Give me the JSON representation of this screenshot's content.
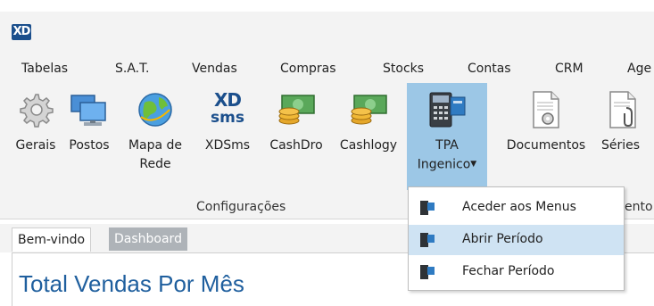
{
  "app": {
    "logo_text": "XD"
  },
  "menubar": {
    "items": [
      "Tabelas",
      "S.A.T.",
      "Vendas",
      "Compras",
      "Stocks",
      "Contas",
      "CRM",
      "Age"
    ]
  },
  "ribbon": {
    "buttons": [
      {
        "line1": "Gerais",
        "line2": "",
        "icon": "gear-icon"
      },
      {
        "line1": "Postos",
        "line2": "",
        "icon": "computer-icon"
      },
      {
        "line1": "Mapa de",
        "line2": "Rede",
        "icon": "globe-icon"
      },
      {
        "line1": "XDSms",
        "line2": "",
        "icon": "xdsms-icon"
      },
      {
        "line1": "CashDro",
        "line2": "",
        "icon": "cash-icon"
      },
      {
        "line1": "Cashlogy",
        "line2": "",
        "icon": "cash-icon"
      },
      {
        "line1": "TPA",
        "line2": "Ingenico",
        "icon": "payment-terminal-icon"
      },
      {
        "line1": "Documentos",
        "line2": "",
        "icon": "document-gear-icon"
      },
      {
        "line1": "Séries",
        "line2": "",
        "icon": "document-clip-icon"
      }
    ],
    "group_label": "Configurações",
    "cut_label": "ento",
    "xdsms_logo": "XD",
    "xdsms_sms": "sms"
  },
  "dropdown": {
    "items": [
      {
        "label": "Aceder aos Menus",
        "hover": false
      },
      {
        "label": "Abrir Período",
        "hover": true
      },
      {
        "label": "Fechar Período",
        "hover": false
      }
    ]
  },
  "tabs": [
    {
      "label": "Bem-vindo",
      "active": false
    },
    {
      "label": "Dashboard",
      "active": true
    }
  ],
  "page": {
    "title": "Total Vendas Por Mês"
  },
  "colors": {
    "accent": "#1f5f9e",
    "active_button": "#9cc7e6",
    "hover_item": "#cfe3f3",
    "logo": "#1b4f8c"
  }
}
